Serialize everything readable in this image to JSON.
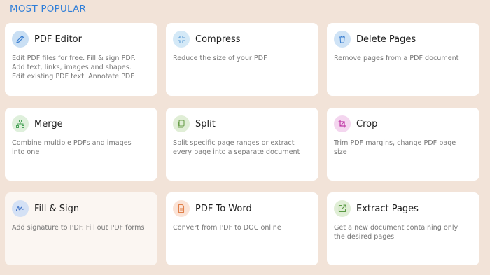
{
  "section": {
    "title": "MOST POPULAR"
  },
  "tools": [
    {
      "title": "PDF Editor",
      "desc": "Edit PDF files for free. Fill & sign PDF. Add text, links, images and shapes. Edit existing PDF text. Annotate PDF",
      "icon": "pencil-icon",
      "color": "#c9dff4"
    },
    {
      "title": "Compress",
      "desc": "Reduce the size of your PDF",
      "icon": "compress-icon",
      "color": "#d4e9f7"
    },
    {
      "title": "Delete Pages",
      "desc": "Remove pages from a PDF document",
      "icon": "trash-icon",
      "color": "#cfe3f6"
    },
    {
      "title": "Merge",
      "desc": "Combine multiple PDFs and images into one",
      "icon": "merge-icon",
      "color": "#dff0dc"
    },
    {
      "title": "Split",
      "desc": "Split specific page ranges or extract every page into a separate document",
      "icon": "split-icon",
      "color": "#e0eed6"
    },
    {
      "title": "Crop",
      "desc": "Trim PDF margins, change PDF page size",
      "icon": "crop-icon",
      "color": "#f4d6ef"
    },
    {
      "title": "Fill & Sign",
      "desc": "Add signature to PDF. Fill out PDF forms",
      "icon": "signature-icon",
      "color": "#d4e1f5"
    },
    {
      "title": "PDF To Word",
      "desc": "Convert from PDF to DOC online",
      "icon": "document-icon",
      "color": "#fbe3d6"
    },
    {
      "title": "Extract Pages",
      "desc": "Get a new document containing only the desired pages",
      "icon": "extract-icon",
      "color": "#e0eed6"
    }
  ]
}
